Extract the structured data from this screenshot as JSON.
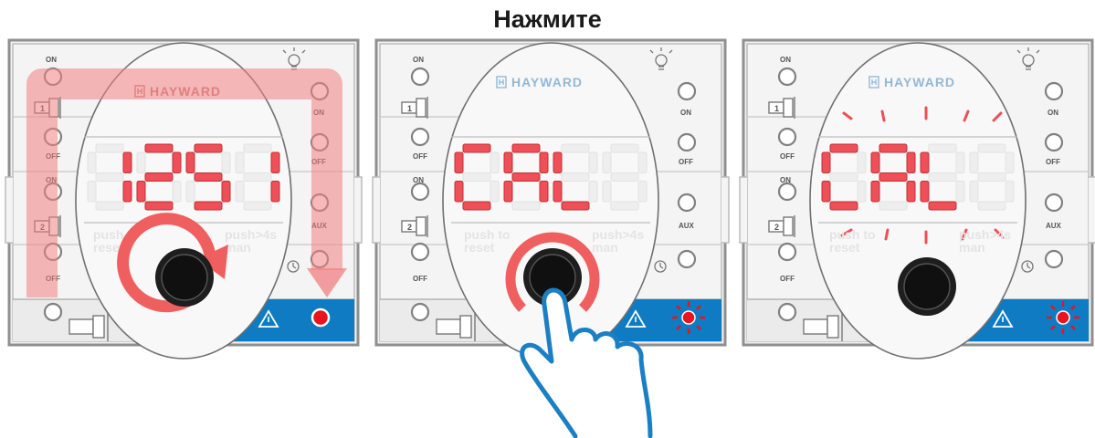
{
  "title": "Нажмите",
  "panels": [
    {
      "brand": "HAYWARD",
      "display": "1251",
      "state": "step-1-rotate",
      "labels": {
        "on": "ON",
        "off": "OFF",
        "aux": "AUX",
        "pump1": "1",
        "pump2": "2",
        "push_reset_1": "push to",
        "push_reset_2": "reset",
        "push_man_1": "push>4s",
        "push_man_2": "man"
      }
    },
    {
      "brand": "HAYWARD",
      "display": "CAL",
      "state": "step-2-press",
      "labels": {
        "on": "ON",
        "off": "OFF",
        "aux": "AUX",
        "pump1": "1",
        "pump2": "2",
        "push_reset_1": "push to",
        "push_reset_2": "reset",
        "push_man_1": "push>4s",
        "push_man_2": "man"
      }
    },
    {
      "brand": "HAYWARD",
      "display": "CAL",
      "state": "step-3-blinking",
      "labels": {
        "on": "ON",
        "off": "OFF",
        "aux": "AUX",
        "pump1": "1",
        "pump2": "2",
        "push_reset_1": "push to",
        "push_reset_2": "reset",
        "push_man_1": "push>4s",
        "push_man_2": "man"
      }
    }
  ],
  "colors": {
    "segment_on": "#ef4f57",
    "segment_off": "#eeeeee",
    "accent_blue": "#0f7bc2",
    "arrow": "#ef6f6f",
    "hand": "#1b7fc4",
    "led_red": "#e8141e"
  }
}
